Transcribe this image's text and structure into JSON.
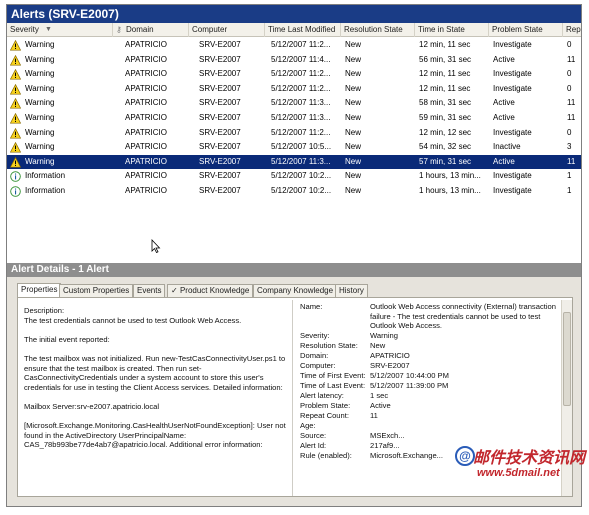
{
  "window": {
    "title": "Alerts (SRV-E2007)"
  },
  "columns": {
    "severity": "Severity",
    "domain": "Domain",
    "computer": "Computer",
    "time_last_modified": "Time Last Modified",
    "resolution_state": "Resolution State",
    "time_in_state": "Time in State",
    "problem_state": "Problem State",
    "repeat": "Rep"
  },
  "alerts": [
    {
      "severity": "Warning",
      "domain": "APATRICIO",
      "computer": "SRV-E2007",
      "time": "5/12/2007 11:2...",
      "resolution": "New",
      "time_in_state": "12 min, 11 sec",
      "problem": "Investigate",
      "repeat": "0",
      "icon": "warning-icon",
      "selected": false
    },
    {
      "severity": "Warning",
      "domain": "APATRICIO",
      "computer": "SRV-E2007",
      "time": "5/12/2007 11:4...",
      "resolution": "New",
      "time_in_state": "56 min, 31 sec",
      "problem": "Active",
      "repeat": "11",
      "icon": "warning-icon",
      "selected": false
    },
    {
      "severity": "Warning",
      "domain": "APATRICIO",
      "computer": "SRV-E2007",
      "time": "5/12/2007 11:2...",
      "resolution": "New",
      "time_in_state": "12 min, 11 sec",
      "problem": "Investigate",
      "repeat": "0",
      "icon": "warning-icon",
      "selected": false
    },
    {
      "severity": "Warning",
      "domain": "APATRICIO",
      "computer": "SRV-E2007",
      "time": "5/12/2007 11:2...",
      "resolution": "New",
      "time_in_state": "12 min, 11 sec",
      "problem": "Investigate",
      "repeat": "0",
      "icon": "warning-icon",
      "selected": false
    },
    {
      "severity": "Warning",
      "domain": "APATRICIO",
      "computer": "SRV-E2007",
      "time": "5/12/2007 11:3...",
      "resolution": "New",
      "time_in_state": "58 min, 31 sec",
      "problem": "Active",
      "repeat": "11",
      "icon": "warning-icon",
      "selected": false
    },
    {
      "severity": "Warning",
      "domain": "APATRICIO",
      "computer": "SRV-E2007",
      "time": "5/12/2007 11:3...",
      "resolution": "New",
      "time_in_state": "59 min, 31 sec",
      "problem": "Active",
      "repeat": "11",
      "icon": "warning-icon",
      "selected": false
    },
    {
      "severity": "Warning",
      "domain": "APATRICIO",
      "computer": "SRV-E2007",
      "time": "5/12/2007 11:2...",
      "resolution": "New",
      "time_in_state": "12 min, 12 sec",
      "problem": "Investigate",
      "repeat": "0",
      "icon": "warning-icon",
      "selected": false
    },
    {
      "severity": "Warning",
      "domain": "APATRICIO",
      "computer": "SRV-E2007",
      "time": "5/12/2007 10:5...",
      "resolution": "New",
      "time_in_state": "54 min, 32 sec",
      "problem": "Inactive",
      "repeat": "3",
      "icon": "warning-icon",
      "selected": false
    },
    {
      "severity": "Warning",
      "domain": "APATRICIO",
      "computer": "SRV-E2007",
      "time": "5/12/2007 11:3...",
      "resolution": "New",
      "time_in_state": "57 min, 31 sec",
      "problem": "Active",
      "repeat": "11",
      "icon": "warning-icon",
      "selected": true
    },
    {
      "severity": "Information",
      "domain": "APATRICIO",
      "computer": "SRV-E2007",
      "time": "5/12/2007 10:2...",
      "resolution": "New",
      "time_in_state": "1 hours, 13 min...",
      "problem": "Investigate",
      "repeat": "1",
      "icon": "info-icon",
      "selected": false
    },
    {
      "severity": "Information",
      "domain": "APATRICIO",
      "computer": "SRV-E2007",
      "time": "5/12/2007 10:2...",
      "resolution": "New",
      "time_in_state": "1 hours, 13 min...",
      "problem": "Investigate",
      "repeat": "1",
      "icon": "info-icon",
      "selected": false
    }
  ],
  "details": {
    "header": "Alert Details - 1 Alert",
    "tabs": [
      "Properties",
      "Custom Properties",
      "Events",
      "Product Knowledge",
      "Company Knowledge",
      "History"
    ],
    "active_tab": "Properties",
    "checked_tab": "Product Knowledge",
    "description_label": "Description:",
    "description": [
      "The test credentials cannot be used to test Outlook Web Access.",
      "The initial event reported:",
      "The test mailbox was not initialized. Run new-TestCasConnectivityUser.ps1 to ensure that the test mailbox is created. Then run set-CasConnectivityCredentials under a system account to store this user's credentials for use in testing the Client Access services. Detailed information:",
      "Mailbox Server:srv-e2007.apatricio.local",
      "[Microsoft.Exchange.Monitoring.CasHealthUserNotFoundException]: User not found in the ActiveDirectory UserPrincipalName: CAS_78b993be77de4ab7@apatricio.local. Additional error information:"
    ],
    "properties": [
      {
        "key": "Name:",
        "value": "Outlook Web Access connectivity (External) transaction failure - The test credentials cannot be used to test Outlook Web Access."
      },
      {
        "key": "Severity:",
        "value": "Warning"
      },
      {
        "key": "Resolution State:",
        "value": "New"
      },
      {
        "key": "Domain:",
        "value": "APATRICIO"
      },
      {
        "key": "Computer:",
        "value": "SRV-E2007"
      },
      {
        "key": "Time of First Event:",
        "value": "5/12/2007 10:44:00 PM"
      },
      {
        "key": "Time of Last Event:",
        "value": "5/12/2007 11:39:00 PM"
      },
      {
        "key": "Alert latency:",
        "value": "1 sec"
      },
      {
        "key": "Problem State:",
        "value": "Active"
      },
      {
        "key": "Repeat Count:",
        "value": "11"
      },
      {
        "key": "Age:",
        "value": ""
      },
      {
        "key": "Source:",
        "value": "MSExch..."
      },
      {
        "key": "Alert Id:",
        "value": "217af9..."
      },
      {
        "key": "Rule (enabled):",
        "value": "Microsoft.Exchange..."
      }
    ]
  },
  "watermark": {
    "text": "邮件技术资讯网",
    "url": "www.5dmail.net",
    "badge": "@"
  },
  "colors": {
    "title_bg": "#1a3c86",
    "selection_bg": "#0a2a78",
    "details_bg": "#8e8e8e",
    "watermark": "#c2272d"
  }
}
